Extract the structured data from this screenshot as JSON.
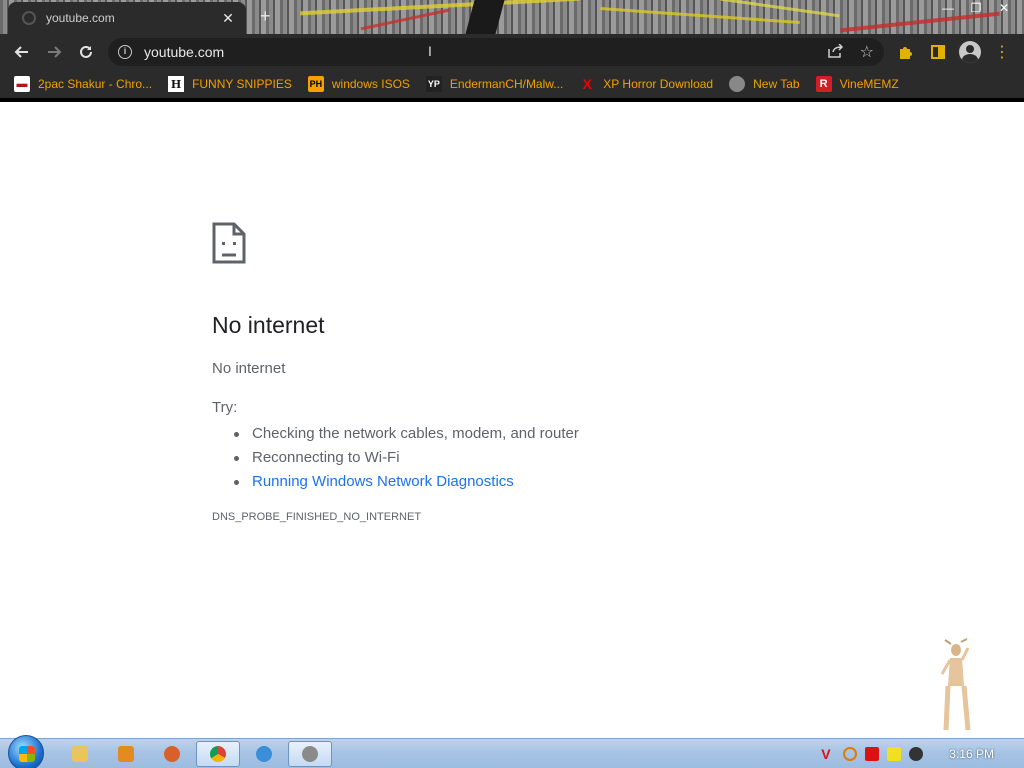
{
  "browser": {
    "tab_title": "youtube.com",
    "tab_close": "✕",
    "new_tab": "+",
    "window_controls": [
      "—",
      "❐",
      "✕"
    ],
    "url": "youtube.com",
    "bookmarks": [
      {
        "label": "2pac Shakur - Chro...",
        "icon": "pac"
      },
      {
        "label": "FUNNY SNIPPIES",
        "icon": "h",
        "icon_text": "H"
      },
      {
        "label": "windows ISOS",
        "icon": "ph",
        "icon_text": "PH"
      },
      {
        "label": "EndermanCH/Malw...",
        "icon": "yp",
        "icon_text": "YP"
      },
      {
        "label": "XP Horror Download",
        "icon": "x",
        "icon_text": "X"
      },
      {
        "label": "New Tab",
        "icon": "nt"
      },
      {
        "label": "VineMEMZ",
        "icon": "r",
        "icon_text": "R"
      }
    ]
  },
  "error_page": {
    "title": "No internet",
    "subtitle": "No internet",
    "try_label": "Try:",
    "suggestions": [
      "Checking the network cables, modem, and router",
      "Reconnecting to Wi-Fi",
      "Running Windows Network Diagnostics"
    ],
    "error_code": "DNS_PROBE_FINISHED_NO_INTERNET"
  },
  "taskbar": {
    "clock": "3:16 PM"
  },
  "colors": {
    "bookmark_text": "#f2a000",
    "link": "#1a73e8",
    "chrome_dark": "#2b2b2b"
  }
}
